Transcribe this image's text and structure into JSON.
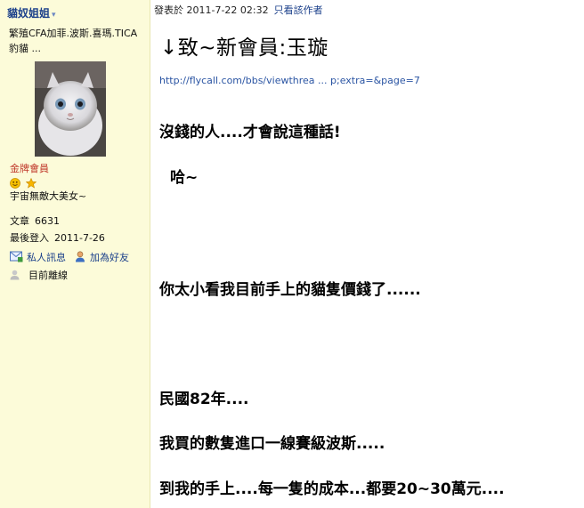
{
  "sidebar": {
    "username": "貓奴姐姐",
    "caret": "▾",
    "description": "繁殖CFA加菲.波斯.喜瑪.TICA豹貓 ...",
    "rank_title": "金牌會員",
    "motto": "宇宙無敵大美女~",
    "stats": [
      {
        "label": "文章",
        "value": "6631"
      },
      {
        "label": "最後登入",
        "value": "2011-7-26"
      }
    ],
    "actions": {
      "pm": "私人訊息",
      "add_friend": "加為好友"
    },
    "status": "目前離線",
    "colors": {
      "background": "#fcfbd9",
      "username": "#1a3f8a",
      "rank": "#c0392b"
    }
  },
  "post": {
    "meta": {
      "posted_at": "發表於 2011-7-22 02:32",
      "only_author": "只看該作者"
    },
    "title": "↓致~新會員:玉璇",
    "link_text": "http://flycall.com/bbs/viewthrea ... p;extra=&page=7",
    "lines": [
      "沒錢的人....才會說這種話!",
      "哈~",
      "你太小看我目前手上的貓隻價錢了......",
      "民國82年....",
      "我買的數隻進口一線賽級波斯.....",
      "到我的手上....每一隻的成本...都要20~30萬元...."
    ]
  }
}
